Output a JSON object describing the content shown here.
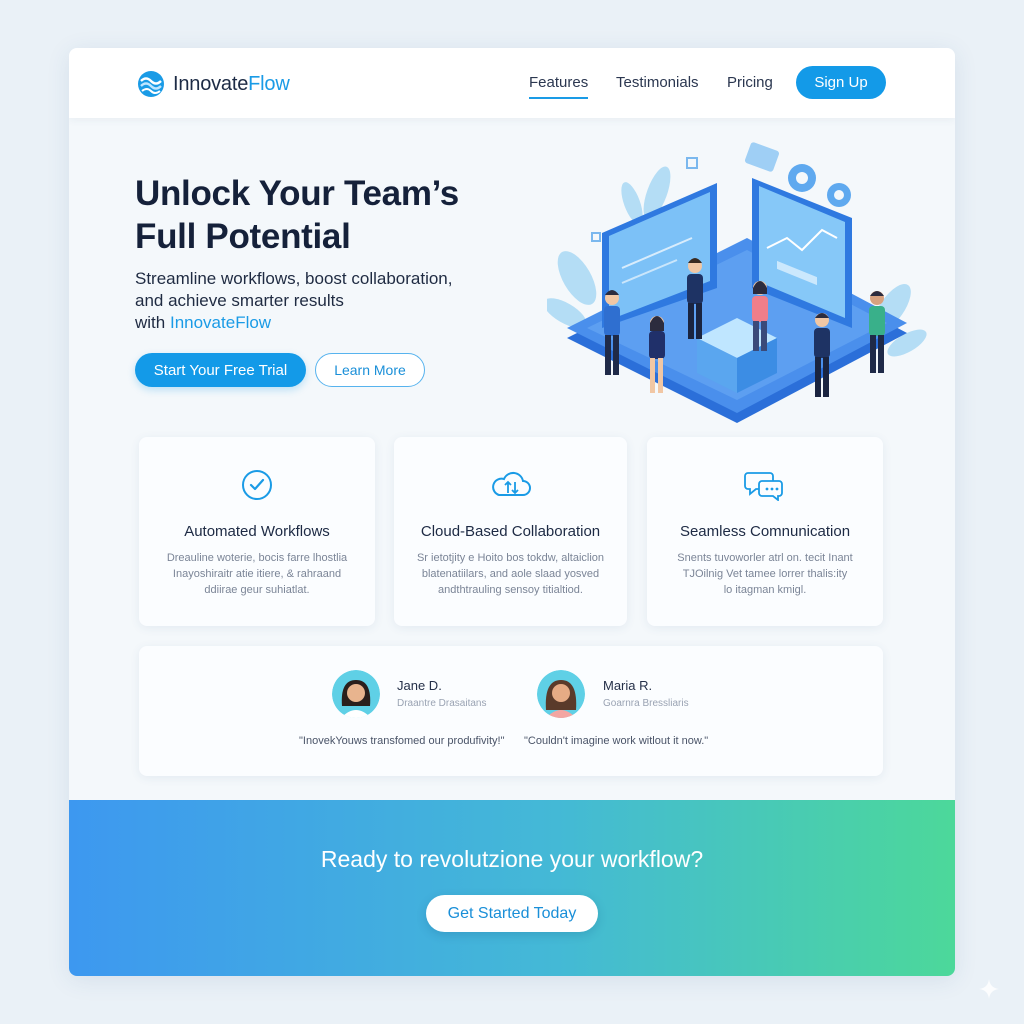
{
  "brand": {
    "name_part1": "Innovate",
    "name_part2": "Flow"
  },
  "nav": {
    "items": [
      "Features",
      "Testimonials",
      "Pricing"
    ],
    "active": "Features",
    "signup_label": "Sign Up"
  },
  "hero": {
    "title_line1": "Unlock Your Team’s",
    "title_line2": "Full Potential",
    "subtitle_line1": "Streamline workflows, boost collaboration,",
    "subtitle_line2": "and achieve smarter results",
    "subtitle_line3_prefix": "with ",
    "subtitle_line3_brand": "InnovateFlow",
    "primary_cta": "Start Your Free Trial",
    "secondary_cta": "Learn More"
  },
  "features": [
    {
      "icon": "check-circle-icon",
      "title": "Automated Workflows",
      "body": [
        "Dreauline woterie, bocis farre lhostlia",
        "Inayoshiraitr atie itiere, & rahraand",
        "ddiirae geur suhiatlat."
      ]
    },
    {
      "icon": "cloud-sync-icon",
      "title": "Cloud-Based Collaboration",
      "body": [
        "Sr ietotjity e Hoito bos tokdw, altaiclion",
        "blatenatiilars, and aole slaad yosved",
        "andthtrauling sensoy titialtiod."
      ]
    },
    {
      "icon": "chat-bubbles-icon",
      "title": "Seamless Comnunication",
      "body": [
        "Snents tuvoworler atrl on. tecit Inant",
        "TJOilnig Vet tamee lorrer thalis:ity",
        "lo itagman kmigl."
      ]
    }
  ],
  "testimonials": [
    {
      "name": "Jane D.",
      "role": "Draantre Drasaitans",
      "quote": "\"InovekYouws transfomed our produfivity!\""
    },
    {
      "name": "Maria R.",
      "role": "Goarnra Bressliaris",
      "quote": "\"Couldn't imagine work witlout it now.\""
    }
  ],
  "cta": {
    "title": "Ready to revolutzione your workflow?",
    "button": "Get Started Today"
  },
  "colors": {
    "accent": "#139ae8",
    "dark_text": "#15213a",
    "gradient_start": "#3d98f0",
    "gradient_end": "#4cd89a"
  }
}
